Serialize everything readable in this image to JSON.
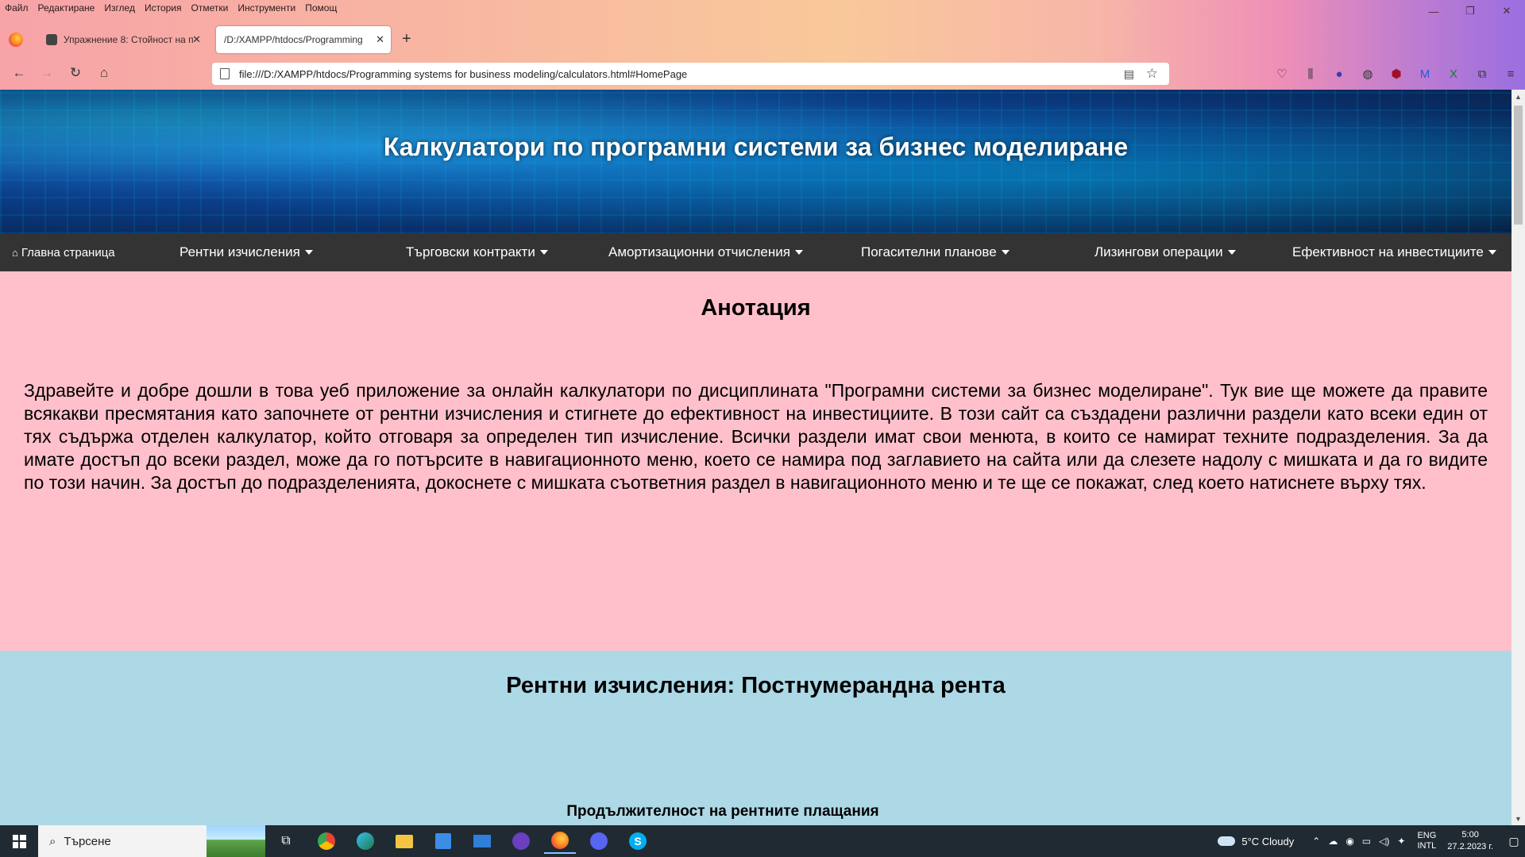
{
  "browser": {
    "menu": [
      "Файл",
      "Редактиране",
      "Изглед",
      "История",
      "Отметки",
      "Инструменти",
      "Помощ"
    ],
    "tabs": [
      {
        "title": "Упражнение 8: Стойност на п",
        "active": false
      },
      {
        "title": "/D:/XAMPP/htdocs/Programming",
        "active": true
      }
    ],
    "url": "file:///D:/XAMPP/htdocs/Programming systems for business modeling/calculators.html#HomePage",
    "window_controls": {
      "minimize": "—",
      "restore": "❐",
      "close": "✕"
    },
    "icons": {
      "new_tab": "+",
      "close_tab": "✕",
      "back": "←",
      "forward": "→",
      "reload": "↻",
      "home": "⌂"
    }
  },
  "site": {
    "title": "Калкулатори по програмни системи за бизнес моделиране",
    "nav": [
      {
        "label": "Главна страница",
        "dropdown": false
      },
      {
        "label": "Рентни изчисления",
        "dropdown": true
      },
      {
        "label": "Търговски контракти",
        "dropdown": true
      },
      {
        "label": "Амортизационни отчисления",
        "dropdown": true
      },
      {
        "label": "Погасителни планове",
        "dropdown": true
      },
      {
        "label": "Лизингови операции",
        "dropdown": true
      },
      {
        "label": "Ефективност на инвестициите",
        "dropdown": true
      }
    ],
    "annotation": {
      "heading": "Анотация",
      "text": "Здравейте и добре дошли в това уеб приложение за онлайн калкулатори по дисциплината \"Програмни системи за бизнес моделиране\". Тук вие ще можете да правите всякакви пресмятания като започнете от рентни изчисления и стигнете до ефективност на инвестициите. В този сайт са създадени различни раздели като всеки един от тях съдържа отделен калкулатор, който отговаря за определен тип изчисление. Всички раздели имат свои менюта, в които се намират техните подразделения. За да имате достъп до всеки раздел, може да го потърсите в навигационното меню, което се намира под заглавието на сайта или да слезете надолу с мишката и да го видите по този начин. За достъп до подразделенията, докоснете с мишката съответния раздел в навигационното меню и те ще се покажат, след което натиснете върху тях."
    },
    "section": {
      "heading": "Рентни изчисления: Постнумерандна рента",
      "field_label": "Продължителност на рентните плащания"
    },
    "colors": {
      "annotation_bg": "#ffc0cb",
      "section_bg": "#add8e6",
      "nav_bg": "#333333"
    }
  },
  "taskbar": {
    "search_placeholder": "Търсене",
    "weather": "5°C  Cloudy",
    "lang_top": "ENG",
    "lang_bottom": "INTL",
    "time": "5:00",
    "date": "27.2.2023 г."
  }
}
